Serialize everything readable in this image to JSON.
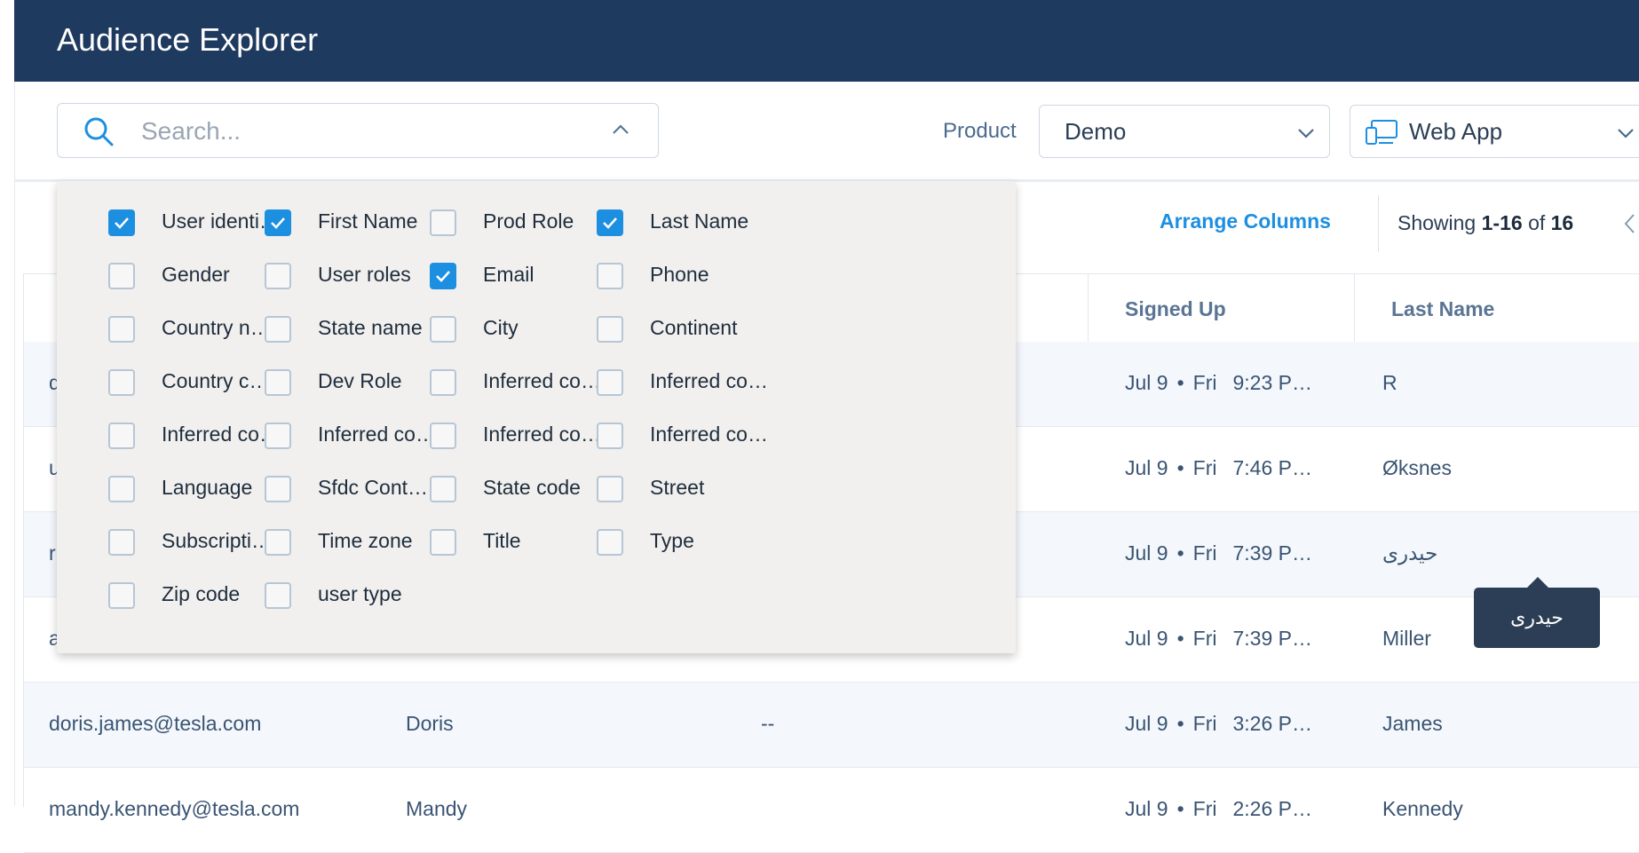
{
  "header": {
    "title": "Audience Explorer"
  },
  "search": {
    "placeholder": "Search..."
  },
  "filters": {
    "product_label": "Product",
    "product_value": "Demo",
    "platform_value": "Web App"
  },
  "toolbar": {
    "arrange_columns": "Arrange Columns",
    "showing_prefix": "Showing",
    "showing_range": "1-16",
    "showing_of": "of",
    "showing_total": "16"
  },
  "columns_panel": {
    "options": [
      {
        "label": "User identi…",
        "checked": true
      },
      {
        "label": "First Name",
        "checked": true
      },
      {
        "label": "Prod Role",
        "checked": false
      },
      {
        "label": "Last Name",
        "checked": true
      },
      {
        "label": "Gender",
        "checked": false
      },
      {
        "label": "User roles",
        "checked": false
      },
      {
        "label": "Email",
        "checked": true
      },
      {
        "label": "Phone",
        "checked": false
      },
      {
        "label": "Country na…",
        "checked": false
      },
      {
        "label": "State name",
        "checked": false
      },
      {
        "label": "City",
        "checked": false
      },
      {
        "label": "Continent",
        "checked": false
      },
      {
        "label": "Country co…",
        "checked": false
      },
      {
        "label": "Dev Role",
        "checked": false
      },
      {
        "label": "Inferred co…",
        "checked": false
      },
      {
        "label": "Inferred co…",
        "checked": false
      },
      {
        "label": "Inferred co…",
        "checked": false
      },
      {
        "label": "Inferred co…",
        "checked": false
      },
      {
        "label": "Inferred co…",
        "checked": false
      },
      {
        "label": "Inferred co…",
        "checked": false
      },
      {
        "label": "Language",
        "checked": false
      },
      {
        "label": "Sfdc Cont…",
        "checked": false
      },
      {
        "label": "State code",
        "checked": false
      },
      {
        "label": "Street",
        "checked": false
      },
      {
        "label": "Subscripti…",
        "checked": false
      },
      {
        "label": "Time zone",
        "checked": false
      },
      {
        "label": "Title",
        "checked": false
      },
      {
        "label": "Type",
        "checked": false
      },
      {
        "label": "Zip code",
        "checked": false
      },
      {
        "label": "user type",
        "checked": false
      }
    ]
  },
  "table": {
    "headers": {
      "signed_up": "Signed Up",
      "last_name": "Last Name"
    },
    "rows": [
      {
        "email": "d",
        "first": "",
        "role": "",
        "date": "Jul 9",
        "dot": "•",
        "day": "Fri",
        "time": "9:23 P…",
        "last": "R"
      },
      {
        "email": "u",
        "first": "",
        "role": "",
        "date": "Jul 9",
        "dot": "•",
        "day": "Fri",
        "time": "7:46 P…",
        "last": "Øksnes"
      },
      {
        "email": "r",
        "first": "",
        "role": "",
        "date": "Jul 9",
        "dot": "•",
        "day": "Fri",
        "time": "7:39 P…",
        "last": "حیدری"
      },
      {
        "email": "a",
        "first": "",
        "role": "",
        "date": "Jul 9",
        "dot": "•",
        "day": "Fri",
        "time": "7:39 P…",
        "last": "Miller"
      },
      {
        "email": "doris.james@tesla.com",
        "first": "Doris",
        "role": "--",
        "date": "Jul 9",
        "dot": "•",
        "day": "Fri",
        "time": "3:26 P…",
        "last": "James"
      },
      {
        "email": "mandy.kennedy@tesla.com",
        "first": "Mandy",
        "role": "",
        "date": "Jul 9",
        "dot": "•",
        "day": "Fri",
        "time": "2:26 P…",
        "last": "Kennedy"
      }
    ]
  },
  "tooltip": {
    "text": "حیدری"
  },
  "colors": {
    "header_bg": "#1f3a5f",
    "accent": "#1d8fe1",
    "panel_bg": "#f1f0ee",
    "tooltip_bg": "#2c3e55"
  },
  "icons": {
    "search": "search-icon",
    "chevron_up": "chevron-up-icon",
    "chevron_down": "chevron-down-icon",
    "device": "devices-icon",
    "prev": "chevron-left-icon",
    "check": "check-icon"
  }
}
